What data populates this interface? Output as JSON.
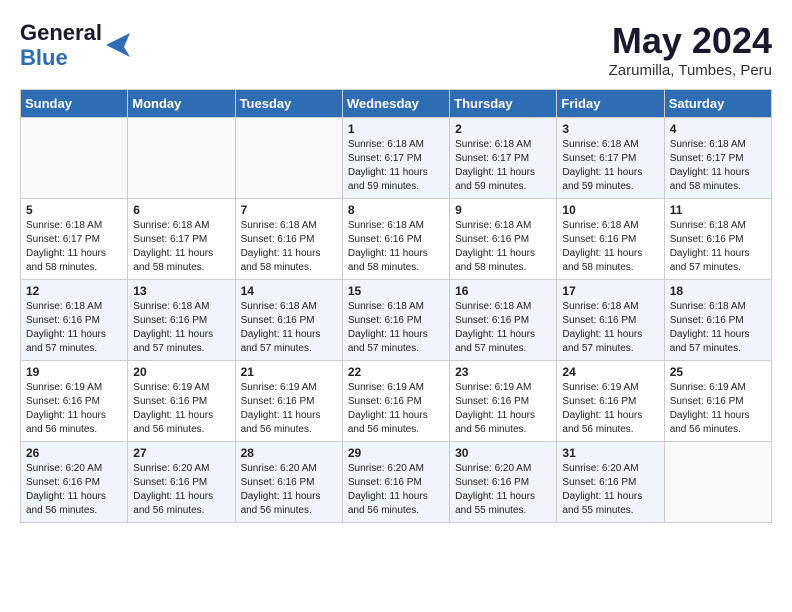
{
  "logo": {
    "line1": "General",
    "line2": "Blue"
  },
  "title": "May 2024",
  "location": "Zarumilla, Tumbes, Peru",
  "weekdays": [
    "Sunday",
    "Monday",
    "Tuesday",
    "Wednesday",
    "Thursday",
    "Friday",
    "Saturday"
  ],
  "weeks": [
    [
      {
        "day": "",
        "content": ""
      },
      {
        "day": "",
        "content": ""
      },
      {
        "day": "",
        "content": ""
      },
      {
        "day": "1",
        "content": "Sunrise: 6:18 AM\nSunset: 6:17 PM\nDaylight: 11 hours\nand 59 minutes."
      },
      {
        "day": "2",
        "content": "Sunrise: 6:18 AM\nSunset: 6:17 PM\nDaylight: 11 hours\nand 59 minutes."
      },
      {
        "day": "3",
        "content": "Sunrise: 6:18 AM\nSunset: 6:17 PM\nDaylight: 11 hours\nand 59 minutes."
      },
      {
        "day": "4",
        "content": "Sunrise: 6:18 AM\nSunset: 6:17 PM\nDaylight: 11 hours\nand 58 minutes."
      }
    ],
    [
      {
        "day": "5",
        "content": "Sunrise: 6:18 AM\nSunset: 6:17 PM\nDaylight: 11 hours\nand 58 minutes."
      },
      {
        "day": "6",
        "content": "Sunrise: 6:18 AM\nSunset: 6:17 PM\nDaylight: 11 hours\nand 58 minutes."
      },
      {
        "day": "7",
        "content": "Sunrise: 6:18 AM\nSunset: 6:16 PM\nDaylight: 11 hours\nand 58 minutes."
      },
      {
        "day": "8",
        "content": "Sunrise: 6:18 AM\nSunset: 6:16 PM\nDaylight: 11 hours\nand 58 minutes."
      },
      {
        "day": "9",
        "content": "Sunrise: 6:18 AM\nSunset: 6:16 PM\nDaylight: 11 hours\nand 58 minutes."
      },
      {
        "day": "10",
        "content": "Sunrise: 6:18 AM\nSunset: 6:16 PM\nDaylight: 11 hours\nand 58 minutes."
      },
      {
        "day": "11",
        "content": "Sunrise: 6:18 AM\nSunset: 6:16 PM\nDaylight: 11 hours\nand 57 minutes."
      }
    ],
    [
      {
        "day": "12",
        "content": "Sunrise: 6:18 AM\nSunset: 6:16 PM\nDaylight: 11 hours\nand 57 minutes."
      },
      {
        "day": "13",
        "content": "Sunrise: 6:18 AM\nSunset: 6:16 PM\nDaylight: 11 hours\nand 57 minutes."
      },
      {
        "day": "14",
        "content": "Sunrise: 6:18 AM\nSunset: 6:16 PM\nDaylight: 11 hours\nand 57 minutes."
      },
      {
        "day": "15",
        "content": "Sunrise: 6:18 AM\nSunset: 6:16 PM\nDaylight: 11 hours\nand 57 minutes."
      },
      {
        "day": "16",
        "content": "Sunrise: 6:18 AM\nSunset: 6:16 PM\nDaylight: 11 hours\nand 57 minutes."
      },
      {
        "day": "17",
        "content": "Sunrise: 6:18 AM\nSunset: 6:16 PM\nDaylight: 11 hours\nand 57 minutes."
      },
      {
        "day": "18",
        "content": "Sunrise: 6:18 AM\nSunset: 6:16 PM\nDaylight: 11 hours\nand 57 minutes."
      }
    ],
    [
      {
        "day": "19",
        "content": "Sunrise: 6:19 AM\nSunset: 6:16 PM\nDaylight: 11 hours\nand 56 minutes."
      },
      {
        "day": "20",
        "content": "Sunrise: 6:19 AM\nSunset: 6:16 PM\nDaylight: 11 hours\nand 56 minutes."
      },
      {
        "day": "21",
        "content": "Sunrise: 6:19 AM\nSunset: 6:16 PM\nDaylight: 11 hours\nand 56 minutes."
      },
      {
        "day": "22",
        "content": "Sunrise: 6:19 AM\nSunset: 6:16 PM\nDaylight: 11 hours\nand 56 minutes."
      },
      {
        "day": "23",
        "content": "Sunrise: 6:19 AM\nSunset: 6:16 PM\nDaylight: 11 hours\nand 56 minutes."
      },
      {
        "day": "24",
        "content": "Sunrise: 6:19 AM\nSunset: 6:16 PM\nDaylight: 11 hours\nand 56 minutes."
      },
      {
        "day": "25",
        "content": "Sunrise: 6:19 AM\nSunset: 6:16 PM\nDaylight: 11 hours\nand 56 minutes."
      }
    ],
    [
      {
        "day": "26",
        "content": "Sunrise: 6:20 AM\nSunset: 6:16 PM\nDaylight: 11 hours\nand 56 minutes."
      },
      {
        "day": "27",
        "content": "Sunrise: 6:20 AM\nSunset: 6:16 PM\nDaylight: 11 hours\nand 56 minutes."
      },
      {
        "day": "28",
        "content": "Sunrise: 6:20 AM\nSunset: 6:16 PM\nDaylight: 11 hours\nand 56 minutes."
      },
      {
        "day": "29",
        "content": "Sunrise: 6:20 AM\nSunset: 6:16 PM\nDaylight: 11 hours\nand 56 minutes."
      },
      {
        "day": "30",
        "content": "Sunrise: 6:20 AM\nSunset: 6:16 PM\nDaylight: 11 hours\nand 55 minutes."
      },
      {
        "day": "31",
        "content": "Sunrise: 6:20 AM\nSunset: 6:16 PM\nDaylight: 11 hours\nand 55 minutes."
      },
      {
        "day": "",
        "content": ""
      }
    ]
  ]
}
